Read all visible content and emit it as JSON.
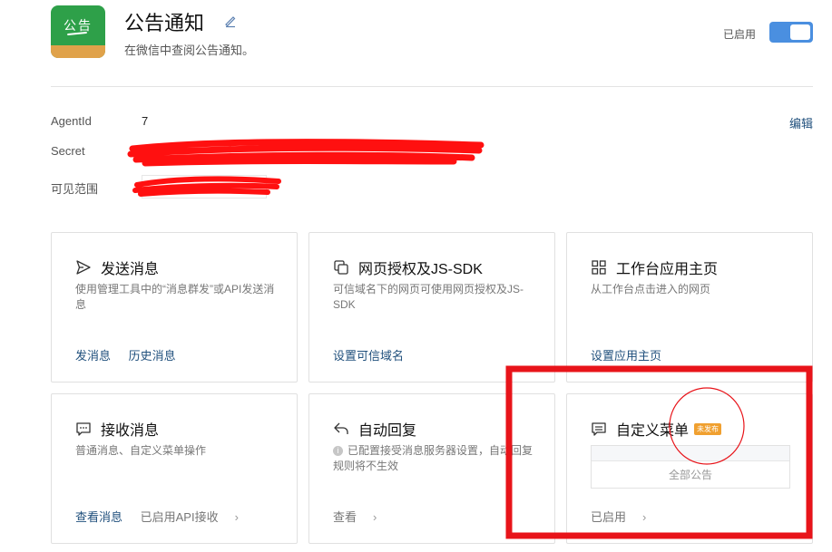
{
  "app": {
    "icon_text": "公告",
    "title": "公告通知",
    "description": "在微信中查阅公告通知。",
    "status_label": "已启用",
    "enabled": true
  },
  "info": {
    "agentid_label": "AgentId",
    "agentid_value": "7",
    "secret_label": "Secret",
    "visible_label": "可见范围",
    "edit_label": "编辑"
  },
  "cards": {
    "send": {
      "title": "发送消息",
      "desc": "使用管理工具中的“消息群发”或API发送消息",
      "link1": "发消息",
      "link2": "历史消息"
    },
    "web": {
      "title": "网页授权及JS-SDK",
      "desc": "可信域名下的网页可使用网页授权及JS-SDK",
      "link1": "设置可信域名"
    },
    "workbench": {
      "title": "工作台应用主页",
      "desc": "从工作台点击进入的网页",
      "link1": "设置应用主页"
    },
    "receive": {
      "title": "接收消息",
      "desc": "普通消息、自定义菜单操作",
      "link1": "查看消息",
      "link2": "已启用API接收"
    },
    "autoreply": {
      "title": "自动回复",
      "desc": "已配置接受消息服务器设置，自动回复规则将不生效",
      "link1": "查看"
    },
    "menu": {
      "title": "自定义菜单",
      "badge": "未发布",
      "preview_item": "全部公告",
      "link1": "已启用"
    }
  },
  "colors": {
    "accent": "#4a8fe0",
    "link": "#1f4f7c",
    "annotation_red": "#e8141a",
    "badge": "#f0a030"
  }
}
